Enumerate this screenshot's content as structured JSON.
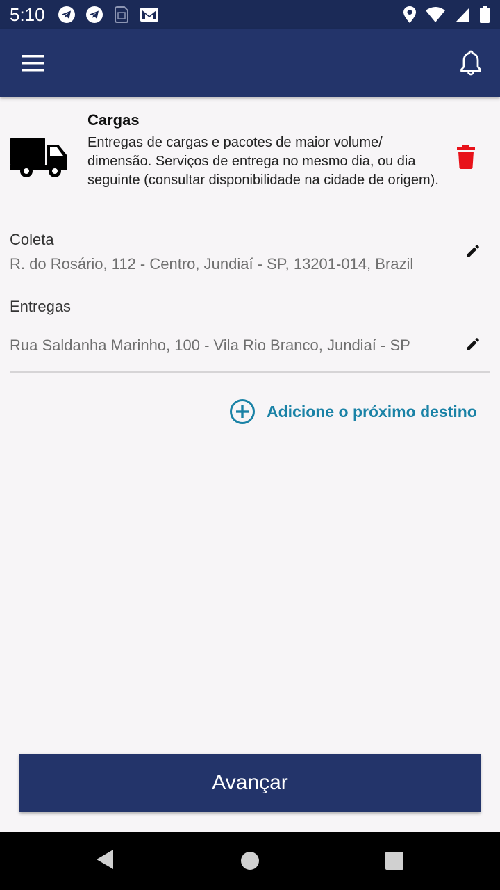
{
  "status_bar": {
    "time": "5:10",
    "left_icons": [
      "telegram-icon",
      "telegram-icon",
      "sim-icon",
      "gmail-icon"
    ],
    "right_icons": [
      "location-icon",
      "wifi-icon",
      "signal-icon",
      "battery-icon"
    ]
  },
  "app_bar": {
    "menu_icon": "hamburger-menu-icon",
    "notification_icon": "bell-icon"
  },
  "service": {
    "icon": "truck-icon",
    "title": "Cargas",
    "description": "Entregas de cargas e pacotes de maior volume/ dimensão. Serviços de entrega no mesmo dia, ou dia seguinte (consultar disponibilidade na cidade de origem).",
    "delete_icon": "trash-icon",
    "delete_color": "#e8121a"
  },
  "pickup": {
    "label": "Coleta",
    "address": "R. do Rosário, 112 - Centro, Jundiaí - SP, 13201-014, Brazil"
  },
  "deliveries": {
    "label": "Entregas",
    "items": [
      {
        "address": "Rua Saldanha Marinho, 100 - Vila Rio Branco, Jundiaí - SP"
      }
    ]
  },
  "add_destination": {
    "label": "Adicione o próximo destino",
    "color": "#1a82a6"
  },
  "primary_button": {
    "label": "Avançar",
    "color": "#23346a"
  },
  "colors": {
    "app_bar": "#23346a",
    "status_bar": "#1b2a57",
    "background": "#f7f5f7"
  }
}
